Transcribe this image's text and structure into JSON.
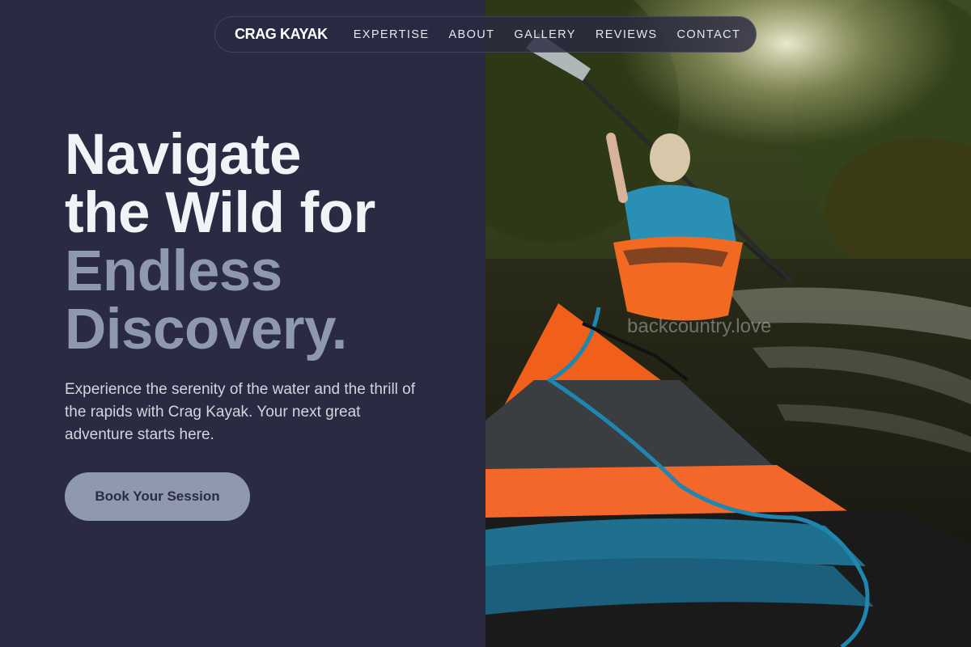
{
  "brand": {
    "name": "CRAG KAYAK"
  },
  "nav": {
    "items": [
      {
        "label": "EXPERTISE"
      },
      {
        "label": "ABOUT"
      },
      {
        "label": "GALLERY"
      },
      {
        "label": "REVIEWS"
      },
      {
        "label": "CONTACT"
      }
    ]
  },
  "hero": {
    "headline": {
      "line1": "Navigate",
      "line2": "the Wild for",
      "line3": "Endless",
      "line4": "Discovery."
    },
    "description": "Experience the serenity of the water and the thrill of the rapids with Crag Kayak. Your next great adventure starts here.",
    "cta_label": "Book Your Session"
  },
  "photo": {
    "watermark": "backcountry.love"
  },
  "colors": {
    "background": "#2a2a42",
    "headline_light": "#f2f3f7",
    "headline_muted": "#8e99ad",
    "button_bg": "#8e99ae",
    "button_text": "#2b2b44"
  }
}
